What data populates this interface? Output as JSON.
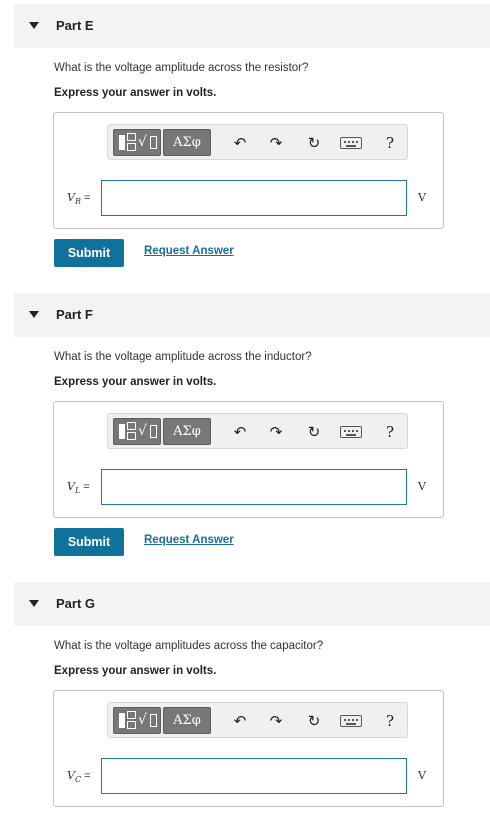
{
  "toolbar": {
    "greek_label": "ΑΣφ",
    "undo_glyph": "↶",
    "redo_glyph": "↷",
    "reset_glyph": "↻",
    "help_label": "?"
  },
  "parts": [
    {
      "title": "Part E",
      "question": "What is the voltage amplitude across the resistor?",
      "instruction": "Express your answer in volts.",
      "var_symbol": "V",
      "var_sub": "R",
      "equals": " =",
      "input_value": "",
      "unit": "V",
      "submit_label": "Submit",
      "request_label": "Request Answer"
    },
    {
      "title": "Part F",
      "question": "What is the voltage amplitude across the inductor?",
      "instruction": "Express your answer in volts.",
      "var_symbol": "V",
      "var_sub": "L",
      "equals": " =",
      "input_value": "",
      "unit": "V",
      "submit_label": "Submit",
      "request_label": "Request Answer"
    },
    {
      "title": "Part G",
      "question": "What is the voltage amplitudes across the capacitor?",
      "instruction": "Express your answer in volts.",
      "var_symbol": "V",
      "var_sub": "C",
      "equals": " =",
      "input_value": "",
      "unit": "V"
    }
  ]
}
